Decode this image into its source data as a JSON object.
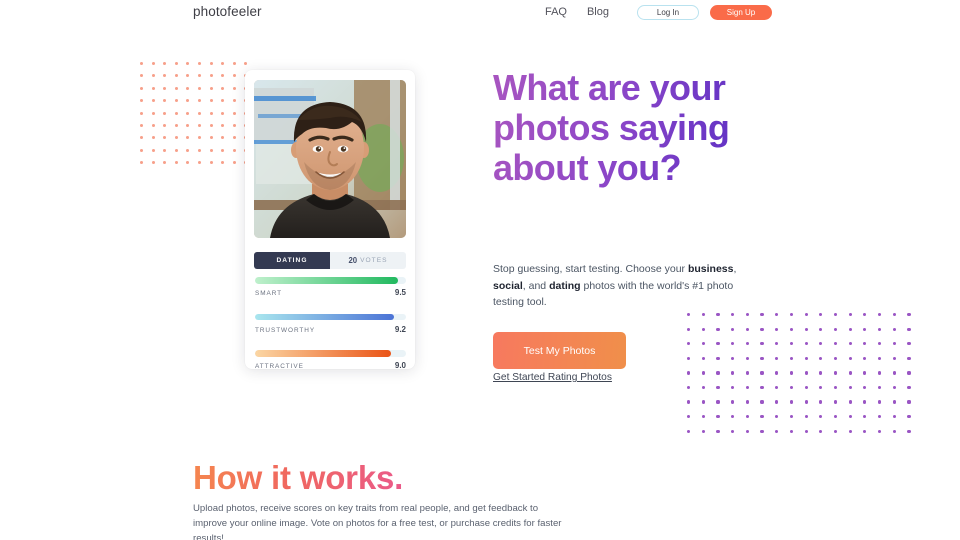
{
  "header": {
    "logo": "photofeeler",
    "nav_links": [
      {
        "label": "FAQ"
      },
      {
        "label": "Blog"
      }
    ],
    "login_label": "Log In",
    "signup_label": "Sign Up",
    "login_border_color": "#b9e2ef",
    "signup_color": "#fa6b49"
  },
  "card": {
    "photo_alt": "Smiling man portrait photo",
    "tab_label": "DATING",
    "votes_count": "20",
    "votes_label": "VOTES",
    "tab_active_color": "#343a52",
    "traits": [
      {
        "name": "SMART",
        "score": "9.5",
        "percent": 95,
        "gradient_from": "#bff0cc",
        "gradient_to": "#21b95f"
      },
      {
        "name": "TRUSTWORTHY",
        "score": "9.2",
        "percent": 92,
        "gradient_from": "#a9e6ee",
        "gradient_to": "#4b73d6"
      },
      {
        "name": "ATTRACTIVE",
        "score": "9.0",
        "percent": 90,
        "gradient_from": "#fbd6a4",
        "gradient_to": "#ea5416"
      }
    ]
  },
  "hero": {
    "title": "What are your photos saying about you?",
    "title_gradient_from": "#a855c0",
    "title_gradient_to": "#5c2fc4",
    "subtitle_parts": [
      {
        "text": "Stop guessing, start testing. Choose your ",
        "bold": false
      },
      {
        "text": "business",
        "bold": true
      },
      {
        "text": ", ",
        "bold": false
      },
      {
        "text": "social",
        "bold": true
      },
      {
        "text": ", and ",
        "bold": false
      },
      {
        "text": "dating",
        "bold": true
      },
      {
        "text": " photos with the world's #1 photo testing tool.",
        "bold": false
      }
    ],
    "cta_label": "Test My Photos",
    "cta_note": "Get Started Rating Photos",
    "cta_gradient_from": "#f7795f",
    "cta_gradient_to": "#f08f4a"
  },
  "how_it_works": {
    "title": "How it works.",
    "title_gradient_from": "#f5864f",
    "title_gradient_to": "#ea5a8a",
    "body": "Upload photos, receive scores on key traits from real people, and get feedback to improve your online image. Vote on photos for a free test, or purchase credits for faster results!"
  },
  "decor": {
    "left_dots": {
      "rows": 9,
      "cols": 10,
      "color": "#f7a08a"
    },
    "right_dots": {
      "rows": 9,
      "cols": 16,
      "color": "#9a55c4"
    }
  }
}
